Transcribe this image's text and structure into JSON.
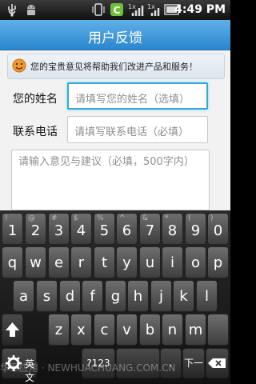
{
  "status_bar": {
    "time": "4:49 PM",
    "icons": [
      "usb-icon",
      "android-icon",
      "vibrate-icon",
      "app-c-icon",
      "signal-3g-icon",
      "signal-icon",
      "battery-icon"
    ],
    "badge_1x": "1x"
  },
  "title": "用户反馈",
  "notice": "您的宝贵意见将帮助我们改进产品和服务！",
  "form": {
    "name_label": "您的姓名",
    "name_placeholder": "请填写您的姓名（选填）",
    "phone_label": "联系电话",
    "phone_placeholder": "请填写联系电话（必填）",
    "feedback_placeholder": "请输入意见与建议（必填，500字内）"
  },
  "keyboard": {
    "number_row": [
      {
        "alt": "!",
        "main": "1"
      },
      {
        "alt": "@",
        "main": "2"
      },
      {
        "alt": "#",
        "main": "3"
      },
      {
        "alt": "$",
        "main": "4"
      },
      {
        "alt": "%",
        "main": "5"
      },
      {
        "alt": "^",
        "main": "6"
      },
      {
        "alt": "&",
        "main": "7"
      },
      {
        "alt": "*",
        "main": "8"
      },
      {
        "alt": "(",
        "main": "9"
      },
      {
        "alt": ")",
        "main": "0"
      }
    ],
    "row1": [
      "q",
      "w",
      "e",
      "r",
      "t",
      "y",
      "u",
      "i",
      "o",
      "p"
    ],
    "row2": [
      "a",
      "s",
      "d",
      "f",
      "g",
      "h",
      "j",
      "k",
      "l"
    ],
    "row3": [
      "z",
      "x",
      "c",
      "v",
      "b",
      "n",
      "m"
    ],
    "lang_key": "英文",
    "symbols_key": "?123",
    "space_key": "",
    "dot_key": ".",
    "enter_key": "下一"
  },
  "watermark": "华军应用 · NEWHUACHUANG.COM.CN",
  "colors": {
    "title_bar": "#2b86cf",
    "focus_border": "#35a8d8",
    "background": "#f2f2f2",
    "key": "#555555"
  }
}
